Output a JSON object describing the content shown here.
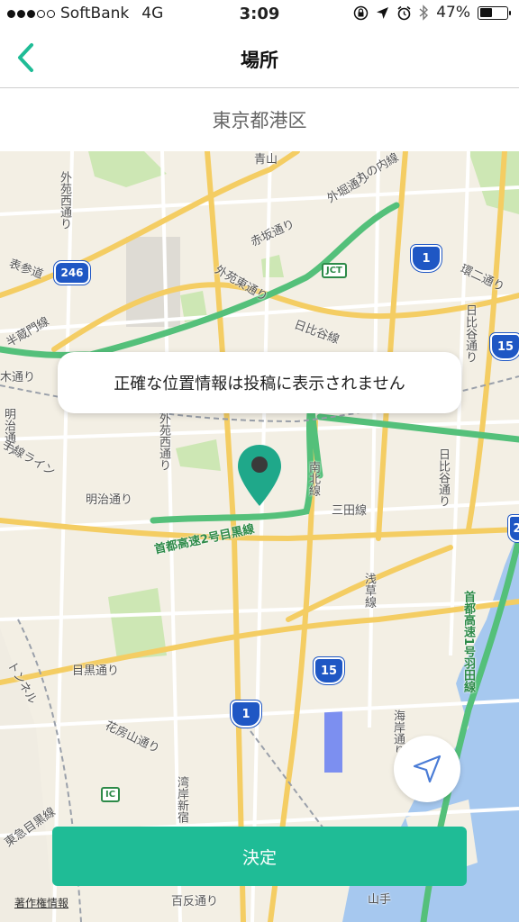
{
  "status_bar": {
    "carrier": "SoftBank",
    "network": "4G",
    "time": "3:09",
    "battery_percent": "47%",
    "battery_level": 0.47
  },
  "nav": {
    "title": "場所"
  },
  "location": {
    "name": "東京都港区"
  },
  "map": {
    "labels": {
      "gaien_nishi_top": "外苑西通り",
      "sotobori": "外堀通り",
      "marunouchi": "丸の内線",
      "omotesando": "表参道",
      "akasaka": "赤坂通り",
      "gaien_higashi": "外苑東通り",
      "kanni": "環二通り",
      "aoyama": "青山",
      "hanzomon": "半蔵門線",
      "hibiya": "日比谷線",
      "hibiya_dori": "日比谷通り",
      "ki_dori": "木通り",
      "meiji_dori_left": "明治通り",
      "yamanote_left": "手線ライン",
      "meiji_dori": "明治通り",
      "gaien_nishi": "外苑西通り",
      "nanboku": "南北線",
      "hibiya_dori_right": "日比谷通り",
      "expressway_2": "首都高速2号目黒線",
      "mita": "三田線",
      "asakusa": "浅草線",
      "expressway_1": "首都高速1号羽田線",
      "meguro": "目黒通り",
      "tunnel": "トンネル",
      "hanabusayama": "花房山通り",
      "tokyu_meguro": "東急目黒線",
      "shuto_shinjuku": "湾岸新宿",
      "kaigan": "海岸通り",
      "hitotsubashi": "百反通り",
      "yamate_bottom": "山手"
    },
    "shields": {
      "r246": "246",
      "r1_top": "1",
      "r15_right": "15",
      "r15_mid": "15",
      "r1_bottom": "1",
      "jct": "JCT",
      "ic": "IC",
      "r2_edge": "2"
    }
  },
  "notice": "正確な位置情報は投稿に表示されません",
  "decide_button_label": "決定",
  "copyright_label": "著作権情報",
  "colors": {
    "accent": "#1fbc96",
    "pin": "#1fa88a",
    "back_chevron": "#1fbc96",
    "highway": "#54c07a",
    "route_shield": "#1f57c4"
  },
  "icons": {
    "back": "chevron-left-icon",
    "pin": "map-pin-icon",
    "locate": "navigation-arrow-icon",
    "orientation_lock": "orientation-lock-icon",
    "location_arrow": "location-arrow-icon",
    "alarm": "alarm-icon",
    "bluetooth": "bluetooth-icon"
  }
}
